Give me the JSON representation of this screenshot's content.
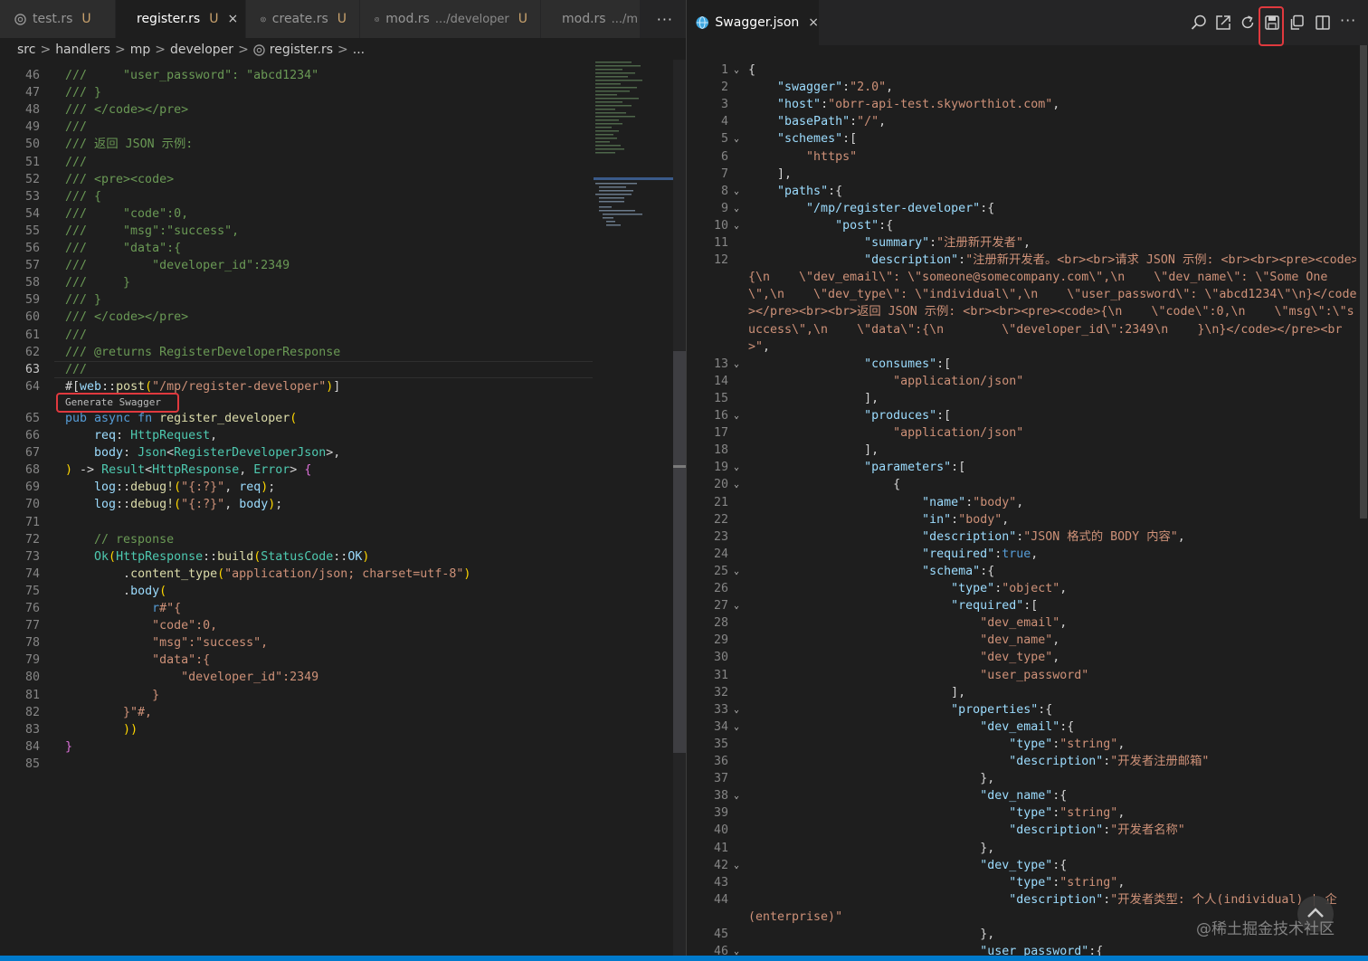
{
  "left_tabs": [
    {
      "label": "test.rs",
      "status": "U",
      "hint": "",
      "active": false
    },
    {
      "label": "register.rs",
      "status": "U",
      "hint": "",
      "active": true,
      "close": "×"
    },
    {
      "label": "create.rs",
      "status": "U",
      "hint": "",
      "active": false
    },
    {
      "label": "mod.rs",
      "status": "U",
      "hint": ".../developer",
      "active": false
    },
    {
      "label": "mod.rs",
      "status": "",
      "hint": ".../m",
      "active": false
    }
  ],
  "left_more": "···",
  "breadcrumb": {
    "items": [
      "src",
      "handlers",
      "mp",
      "developer",
      "register.rs",
      "..."
    ],
    "separator": ">"
  },
  "codelens_label": "Generate Swagger",
  "current_line": 63,
  "left_lines": [
    {
      "n": "46",
      "t": "///     \"user_password\": \"abcd1234\""
    },
    {
      "n": "47",
      "t": "/// }"
    },
    {
      "n": "48",
      "t": "/// </code></pre>"
    },
    {
      "n": "49",
      "t": "///"
    },
    {
      "n": "50",
      "t": "/// 返回 JSON 示例:"
    },
    {
      "n": "51",
      "t": "///"
    },
    {
      "n": "52",
      "t": "/// <pre><code>"
    },
    {
      "n": "53",
      "t": "/// {"
    },
    {
      "n": "54",
      "t": "///     \"code\":0,"
    },
    {
      "n": "55",
      "t": "///     \"msg\":\"success\","
    },
    {
      "n": "56",
      "t": "///     \"data\":{"
    },
    {
      "n": "57",
      "t": "///         \"developer_id\":2349"
    },
    {
      "n": "58",
      "t": "///     }"
    },
    {
      "n": "59",
      "t": "/// }"
    },
    {
      "n": "60",
      "t": "/// </code></pre>"
    },
    {
      "n": "61",
      "t": "///"
    },
    {
      "n": "62",
      "t": "/// @returns RegisterDeveloperResponse"
    },
    {
      "n": "63",
      "t": "///"
    },
    {
      "n": "64",
      "t": "#[web::post(\"/mp/register-developer\")]"
    },
    {
      "n": "65",
      "t": "pub async fn register_developer("
    },
    {
      "n": "66",
      "t": "    req: HttpRequest,"
    },
    {
      "n": "67",
      "t": "    body: Json<RegisterDeveloperJson>,"
    },
    {
      "n": "68",
      "t": ") -> Result<HttpResponse, Error> {"
    },
    {
      "n": "69",
      "t": "    log::debug!(\"{:?}\", req);"
    },
    {
      "n": "70",
      "t": "    log::debug!(\"{:?}\", body);"
    },
    {
      "n": "71",
      "t": ""
    },
    {
      "n": "72",
      "t": "    // response"
    },
    {
      "n": "73",
      "t": "    Ok(HttpResponse::build(StatusCode::OK)"
    },
    {
      "n": "74",
      "t": "        .content_type(\"application/json; charset=utf-8\")"
    },
    {
      "n": "75",
      "t": "        .body("
    },
    {
      "n": "76",
      "t": "            r#\"{"
    },
    {
      "n": "77",
      "t": "            \"code\":0,"
    },
    {
      "n": "78",
      "t": "            \"msg\":\"success\","
    },
    {
      "n": "79",
      "t": "            \"data\":{"
    },
    {
      "n": "80",
      "t": "                \"developer_id\":2349"
    },
    {
      "n": "81",
      "t": "            }"
    },
    {
      "n": "82",
      "t": "        }\"#,"
    },
    {
      "n": "83",
      "t": "        ))"
    },
    {
      "n": "84",
      "t": "}"
    },
    {
      "n": "85",
      "t": ""
    }
  ],
  "right_tab": {
    "label": "Swagger.json",
    "close": "×"
  },
  "right_toolbar": [
    "search-icon",
    "open-external-icon",
    "refresh-icon",
    "save-icon",
    "copy-icon",
    "split-editor-icon"
  ],
  "right_more": "···",
  "right_lines": [
    {
      "n": "1",
      "fold": true,
      "t": "{"
    },
    {
      "n": "2",
      "t": "    \"swagger\":\"2.0\","
    },
    {
      "n": "3",
      "t": "    \"host\":\"obrr-api-test.skyworthiot.com\","
    },
    {
      "n": "4",
      "t": "    \"basePath\":\"/\","
    },
    {
      "n": "5",
      "fold": true,
      "t": "    \"schemes\":["
    },
    {
      "n": "6",
      "t": "        \"https\""
    },
    {
      "n": "7",
      "t": "    ],"
    },
    {
      "n": "8",
      "fold": true,
      "t": "    \"paths\":{"
    },
    {
      "n": "9",
      "fold": true,
      "t": "        \"/mp/register-developer\":{"
    },
    {
      "n": "10",
      "fold": true,
      "t": "            \"post\":{"
    },
    {
      "n": "11",
      "t": "                \"summary\":\"注册新开发者\","
    },
    {
      "n": "12",
      "t": "                \"description\":\"注册新开发者。<br><br>请求 JSON 示例: <br><br><pre><code>"
    },
    {
      "n": "",
      "t": "{\\n    \\\"dev_email\\\": \\\"someone@somecompany.com\\\",\\n    \\\"dev_name\\\": \\\"Some One"
    },
    {
      "n": "",
      "t": "\\\",\\n    \\\"dev_type\\\": \\\"individual\\\",\\n    \\\"user_password\\\": \\\"abcd1234\\\"\\n}</code"
    },
    {
      "n": "",
      "t": "></pre><br><br>返回 JSON 示例: <br><br><pre><code>{\\n    \\\"code\\\":0,\\n    \\\"msg\\\":\\\"s"
    },
    {
      "n": "",
      "t": "uccess\\\",\\n    \\\"data\\\":{\\n        \\\"developer_id\\\":2349\\n    }\\n}</code></pre><br"
    },
    {
      "n": "",
      "t": ">\","
    },
    {
      "n": "13",
      "fold": true,
      "t": "                \"consumes\":["
    },
    {
      "n": "14",
      "t": "                    \"application/json\""
    },
    {
      "n": "15",
      "t": "                ],"
    },
    {
      "n": "16",
      "fold": true,
      "t": "                \"produces\":["
    },
    {
      "n": "17",
      "t": "                    \"application/json\""
    },
    {
      "n": "18",
      "t": "                ],"
    },
    {
      "n": "19",
      "fold": true,
      "t": "                \"parameters\":["
    },
    {
      "n": "20",
      "fold": true,
      "t": "                    {"
    },
    {
      "n": "21",
      "t": "                        \"name\":\"body\","
    },
    {
      "n": "22",
      "t": "                        \"in\":\"body\","
    },
    {
      "n": "23",
      "t": "                        \"description\":\"JSON 格式的 BODY 内容\","
    },
    {
      "n": "24",
      "t": "                        \"required\":true,"
    },
    {
      "n": "25",
      "fold": true,
      "t": "                        \"schema\":{"
    },
    {
      "n": "26",
      "t": "                            \"type\":\"object\","
    },
    {
      "n": "27",
      "fold": true,
      "t": "                            \"required\":["
    },
    {
      "n": "28",
      "t": "                                \"dev_email\","
    },
    {
      "n": "29",
      "t": "                                \"dev_name\","
    },
    {
      "n": "30",
      "t": "                                \"dev_type\","
    },
    {
      "n": "31",
      "t": "                                \"user_password\""
    },
    {
      "n": "32",
      "t": "                            ],"
    },
    {
      "n": "33",
      "fold": true,
      "t": "                            \"properties\":{"
    },
    {
      "n": "34",
      "fold": true,
      "t": "                                \"dev_email\":{"
    },
    {
      "n": "35",
      "t": "                                    \"type\":\"string\","
    },
    {
      "n": "36",
      "t": "                                    \"description\":\"开发者注册邮箱\""
    },
    {
      "n": "37",
      "t": "                                },"
    },
    {
      "n": "38",
      "fold": true,
      "t": "                                \"dev_name\":{"
    },
    {
      "n": "39",
      "t": "                                    \"type\":\"string\","
    },
    {
      "n": "40",
      "t": "                                    \"description\":\"开发者名称\""
    },
    {
      "n": "41",
      "t": "                                },"
    },
    {
      "n": "42",
      "fold": true,
      "t": "                                \"dev_type\":{"
    },
    {
      "n": "43",
      "t": "                                    \"type\":\"string\","
    },
    {
      "n": "44",
      "t": "                                    \"description\":\"开发者类型: 个人(individual) | 企"
    },
    {
      "n": "",
      "t": "(enterprise)\""
    },
    {
      "n": "45",
      "t": "                                },"
    },
    {
      "n": "46",
      "fold": true,
      "t": "                                \"user_password\":{"
    }
  ],
  "watermark": "@稀土掘金技术社区",
  "colors": {
    "accent": "#007acc",
    "highlight": "#e0393e",
    "background": "#1e1e1e"
  }
}
